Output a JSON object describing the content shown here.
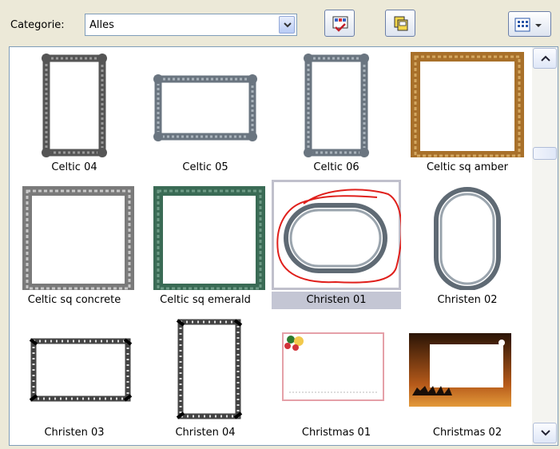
{
  "toolbar": {
    "category_label": "Categorie:",
    "category_value": "Alles",
    "add_icon": "add-to-gallery-icon",
    "copy_icon": "copy-pages-icon",
    "view_icon": "view-options-icon"
  },
  "gallery": {
    "selected": "Christen 01",
    "items": [
      {
        "label": "Celtic 04"
      },
      {
        "label": "Celtic 05"
      },
      {
        "label": "Celtic 06"
      },
      {
        "label": "Celtic sq amber"
      },
      {
        "label": "Celtic sq concrete"
      },
      {
        "label": "Celtic sq emerald"
      },
      {
        "label": "Christen 01"
      },
      {
        "label": "Christen 02"
      },
      {
        "label": "Christen 03"
      },
      {
        "label": "Christen 04"
      },
      {
        "label": "Christmas 01"
      },
      {
        "label": "Christmas 02"
      }
    ]
  },
  "colors": {
    "background": "#ece9d8",
    "border": "#7f9db9",
    "annotation": "#e0201c",
    "amber": "#a8702a",
    "emerald": "#3a6b55",
    "concrete": "#8a8a8a"
  }
}
